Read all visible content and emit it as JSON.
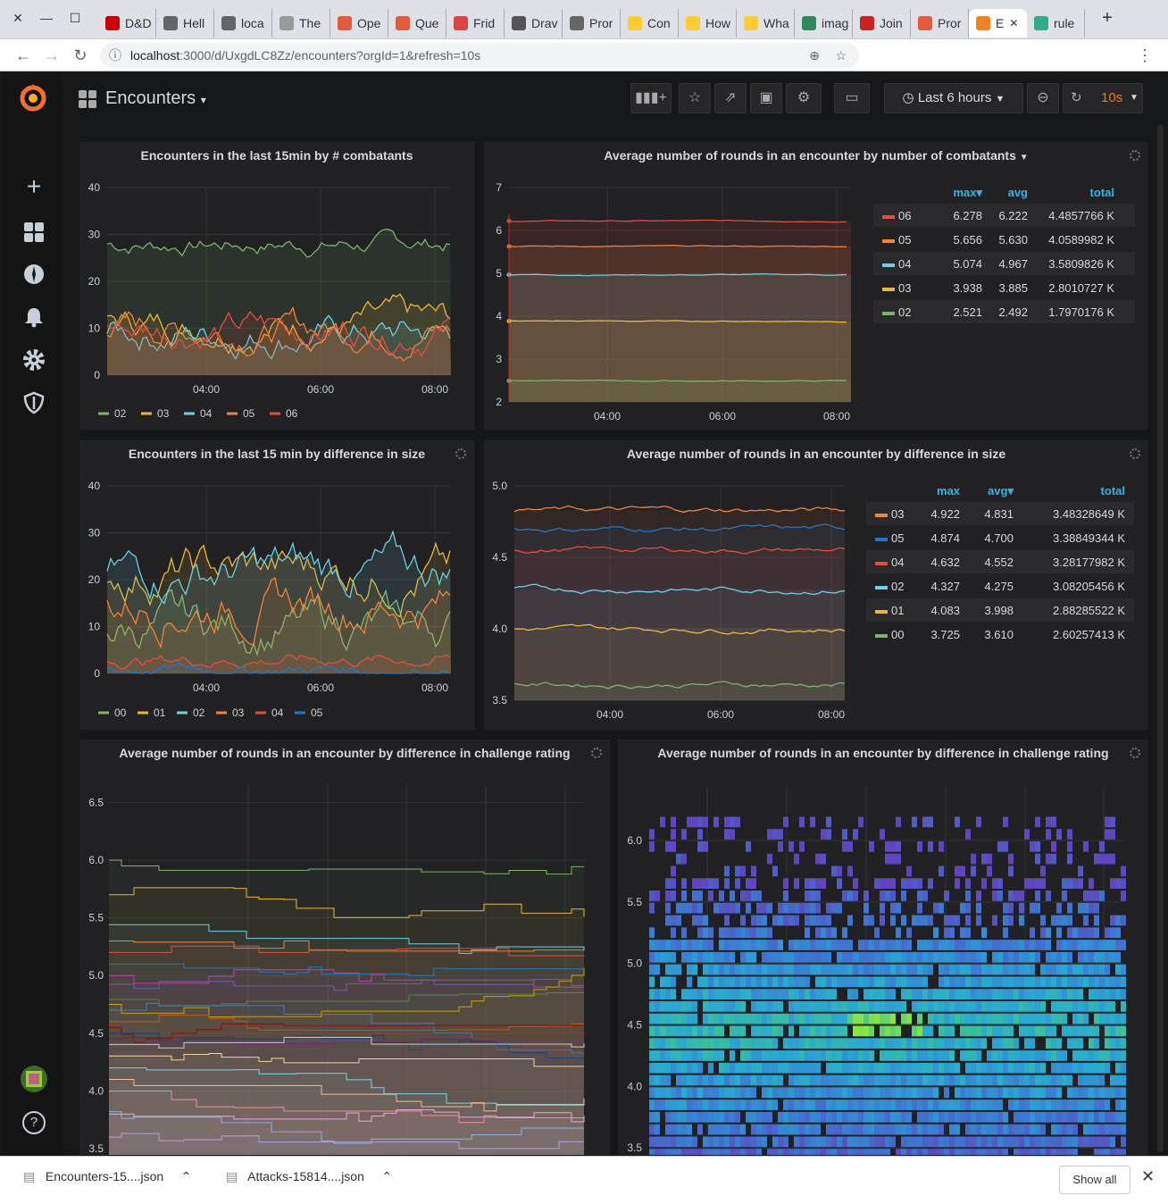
{
  "browser": {
    "tabs": [
      {
        "label": "D&D",
        "color": "#c00"
      },
      {
        "label": "Hell",
        "color": "#666"
      },
      {
        "label": "loca",
        "color": "#666"
      },
      {
        "label": "The",
        "color": "#999"
      },
      {
        "label": "Ope",
        "color": "#e25b3a"
      },
      {
        "label": "Que",
        "color": "#e25b3a"
      },
      {
        "label": "Frid",
        "color": "#d44"
      },
      {
        "label": "Drav",
        "color": "#555"
      },
      {
        "label": "Pror",
        "color": "#666"
      },
      {
        "label": "Con",
        "color": "#ffcc33"
      },
      {
        "label": "How",
        "color": "#ffcc33"
      },
      {
        "label": "Wha",
        "color": "#ffcc33"
      },
      {
        "label": "imag",
        "color": "#2e8b57"
      },
      {
        "label": "Join",
        "color": "#c22"
      },
      {
        "label": "Pror",
        "color": "#e25b3a"
      },
      {
        "label": "E",
        "color": "#f58220"
      },
      {
        "label": "rule",
        "color": "#3a8"
      }
    ],
    "active_tab": 15,
    "url_host": "localhost",
    "url_rest": ":3000/d/UxgdLC8Zz/encounters?orgId=1&refresh=10s"
  },
  "dashboard": {
    "title": "Encounters",
    "time_range": "Last 6 hours",
    "refresh": "10s"
  },
  "panels": {
    "p1": {
      "title": "Encounters in the last 15min by # combatants"
    },
    "p2": {
      "title": "Average number of rounds in an encounter by number of combatants",
      "headers": [
        "max",
        "avg",
        "total"
      ],
      "rows": [
        {
          "name": "06",
          "max": "6.278",
          "avg": "6.222",
          "total": "4.4857766 K",
          "color": "#e24d42"
        },
        {
          "name": "05",
          "max": "5.656",
          "avg": "5.630",
          "total": "4.0589982 K",
          "color": "#ef843c"
        },
        {
          "name": "04",
          "max": "5.074",
          "avg": "4.967",
          "total": "3.5809826 K",
          "color": "#6ed0e0"
        },
        {
          "name": "03",
          "max": "3.938",
          "avg": "3.885",
          "total": "2.8010727 K",
          "color": "#eab839"
        },
        {
          "name": "02",
          "max": "2.521",
          "avg": "2.492",
          "total": "1.7970176 K",
          "color": "#7eb26d"
        }
      ]
    },
    "p3": {
      "title": "Encounters in the last 15 min by difference in size"
    },
    "p4": {
      "title": "Average number of rounds in an encounter by difference in size",
      "headers": [
        "max",
        "avg",
        "total"
      ],
      "rows": [
        {
          "name": "03",
          "max": "4.922",
          "avg": "4.831",
          "total": "3.48328649 K",
          "color": "#ef843c"
        },
        {
          "name": "05",
          "max": "4.874",
          "avg": "4.700",
          "total": "3.38849344 K",
          "color": "#1f78c1"
        },
        {
          "name": "04",
          "max": "4.632",
          "avg": "4.552",
          "total": "3.28177982 K",
          "color": "#e24d42"
        },
        {
          "name": "02",
          "max": "4.327",
          "avg": "4.275",
          "total": "3.08205456 K",
          "color": "#6ed0e0"
        },
        {
          "name": "01",
          "max": "4.083",
          "avg": "3.998",
          "total": "2.88285522 K",
          "color": "#eab839"
        },
        {
          "name": "00",
          "max": "3.725",
          "avg": "3.610",
          "total": "2.60257413 K",
          "color": "#7eb26d"
        }
      ]
    },
    "p5": {
      "title": "Average number of rounds in an encounter by difference in challenge rating"
    },
    "p6": {
      "title": "Average number of rounds in an encounter by difference in challenge rating"
    }
  },
  "chart_data": [
    {
      "type": "line",
      "title": "Encounters in the last 15min by # combatants",
      "x_ticks": [
        "04:00",
        "06:00",
        "08:00"
      ],
      "ylim": [
        0,
        40
      ],
      "y_ticks": [
        0,
        10,
        20,
        30,
        40
      ],
      "series": [
        {
          "name": "02",
          "approx_level": 28
        },
        {
          "name": "03",
          "approx_level": 11
        },
        {
          "name": "04",
          "approx_level": 9
        },
        {
          "name": "05",
          "approx_level": 10
        },
        {
          "name": "06",
          "approx_level": 10
        }
      ]
    },
    {
      "type": "area",
      "title": "Average number of rounds in an encounter by number of combatants",
      "x_ticks": [
        "04:00",
        "06:00",
        "08:00"
      ],
      "ylim": [
        2,
        7
      ],
      "y_ticks": [
        2,
        3,
        4,
        5,
        6,
        7
      ],
      "series": [
        {
          "name": "06",
          "avg": 6.222
        },
        {
          "name": "05",
          "avg": 5.63
        },
        {
          "name": "04",
          "avg": 4.967
        },
        {
          "name": "03",
          "avg": 3.885
        },
        {
          "name": "02",
          "avg": 2.492
        }
      ]
    },
    {
      "type": "line",
      "title": "Encounters in the last 15 min by difference in size",
      "x_ticks": [
        "04:00",
        "06:00",
        "08:00"
      ],
      "ylim": [
        0,
        40
      ],
      "y_ticks": [
        0,
        10,
        20,
        30,
        40
      ],
      "series": [
        {
          "name": "00",
          "approx_level": 10
        },
        {
          "name": "01",
          "approx_level": 22
        },
        {
          "name": "02",
          "approx_level": 22
        },
        {
          "name": "03",
          "approx_level": 15
        },
        {
          "name": "04",
          "approx_level": 3
        },
        {
          "name": "05",
          "approx_level": 1
        }
      ]
    },
    {
      "type": "area",
      "title": "Average number of rounds in an encounter by difference in size",
      "x_ticks": [
        "04:00",
        "06:00",
        "08:00"
      ],
      "ylim": [
        3.5,
        5
      ],
      "y_ticks": [
        3.5,
        4.0,
        4.5,
        5.0
      ],
      "series": [
        {
          "name": "03",
          "avg": 4.831
        },
        {
          "name": "05",
          "avg": 4.7
        },
        {
          "name": "04",
          "avg": 4.552
        },
        {
          "name": "02",
          "avg": 4.275
        },
        {
          "name": "01",
          "avg": 3.998
        },
        {
          "name": "00",
          "avg": 3.61
        }
      ]
    },
    {
      "type": "area",
      "title": "Average number of rounds in an encounter by difference in challenge rating",
      "ylim": [
        3.5,
        6.5
      ],
      "y_ticks": [
        3.5,
        4.0,
        4.5,
        5.0,
        5.5,
        6.0,
        6.5
      ]
    },
    {
      "type": "heatmap",
      "title": "Average number of rounds in an encounter by difference in challenge rating",
      "y_ticks": [
        3.5,
        4.0,
        4.5,
        5.0,
        5.5,
        6.0
      ]
    }
  ],
  "downloads": [
    {
      "name": "Encounters-15....json"
    },
    {
      "name": "Attacks-15814....json"
    }
  ],
  "show_all": "Show all"
}
